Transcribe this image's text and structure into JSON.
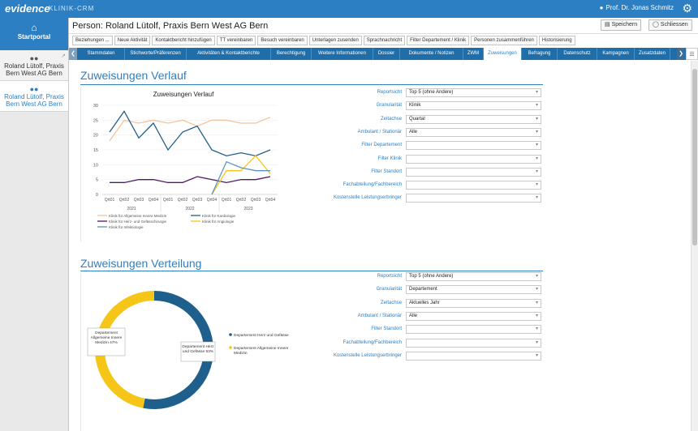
{
  "app": {
    "logo": "evidence",
    "subtitle": "KLINIK-CRM",
    "user": "Prof. Dr. Jonas Schmitz"
  },
  "sidebar": {
    "start": "Startportal",
    "items": [
      {
        "label": "Roland Lütolf, Praxis Bern West AG Bern"
      },
      {
        "label": "Roland Lütolf, Praxis Bern West AG Bern"
      }
    ]
  },
  "header": {
    "title": "Person: Roland Lütolf, Praxis Bern West AG Bern",
    "save": "Speichern",
    "close": "Schliessen"
  },
  "actions": [
    "Beziehungen ...",
    "Neue Aktivität",
    "Kontaktbericht hinzufügen",
    "TT vereinbaren",
    "Besuch vereinbaren",
    "Unterlagen zusenden",
    "Sprachnachricht",
    "Filter Departement / Klinik",
    "Personen zusammenführen",
    "Historisierung"
  ],
  "tabs": [
    "Stammdaten",
    "Stichworte/Präferenzen",
    "Aktivitäten & Kontaktberichte",
    "Berechtigung",
    "Weitere Informationen",
    "Dossier",
    "Dokumente / Notizen",
    "ZWM",
    "Zuweisungen",
    "Befragung",
    "Datenschutz",
    "Kampagnen",
    "Zusatzdaten"
  ],
  "active_tab": "Zuweisungen",
  "section1": {
    "title": "Zuweisungen Verlauf",
    "filters": [
      {
        "label": "Reportsicht",
        "value": "Top 5 (ohne Andere)"
      },
      {
        "label": "Granularität",
        "value": "Klinik"
      },
      {
        "label": "Zeitachse",
        "value": "Quartal"
      },
      {
        "label": "Ambulant / Stationär",
        "value": "Alle"
      },
      {
        "label": "Filter Departement",
        "value": ""
      },
      {
        "label": "Filter Klinik",
        "value": ""
      },
      {
        "label": "Filter Standort",
        "value": ""
      },
      {
        "label": "Fachabteilung/Fachbereich",
        "value": ""
      },
      {
        "label": "Kostenstelle Leistungserbringer",
        "value": ""
      }
    ]
  },
  "section2": {
    "title": "Zuweisungen Verteilung",
    "filters": [
      {
        "label": "Reportsicht",
        "value": "Top 5 (ohne Andere)"
      },
      {
        "label": "Granularität",
        "value": "Departement"
      },
      {
        "label": "Zeitachse",
        "value": "Aktuelles Jahr"
      },
      {
        "label": "Ambulant / Stationär",
        "value": "Alle"
      },
      {
        "label": "Filter Standort",
        "value": ""
      },
      {
        "label": "Fachabteilung/Fachbereich",
        "value": ""
      },
      {
        "label": "Kostenstelle Leistungserbringer",
        "value": ""
      }
    ]
  },
  "chart_data": [
    {
      "type": "line",
      "title": "Zuweisungen Verlauf",
      "categories": [
        "Qrt01",
        "Qrt02",
        "Qrt03",
        "Qrt04",
        "Qrt01",
        "Qrt02",
        "Qrt03",
        "Qrt04",
        "Qrt01",
        "Qrt02",
        "Qrt03",
        "Qrt04"
      ],
      "groups": [
        {
          "label": "2021",
          "from": 0,
          "to": 3
        },
        {
          "label": "2022",
          "from": 4,
          "to": 7
        },
        {
          "label": "2023",
          "from": 8,
          "to": 11
        }
      ],
      "ylim": [
        0,
        30
      ],
      "yticks": [
        0,
        5,
        10,
        15,
        20,
        25,
        30
      ],
      "legend_position": "bottom",
      "series": [
        {
          "name": "Klinik für Allgemeine Innere Medizin",
          "color": "#f4c49a",
          "values": [
            18,
            25,
            24,
            25,
            24,
            25,
            23,
            25,
            25,
            24,
            24,
            26
          ]
        },
        {
          "name": "Klinik für Kardiologie",
          "color": "#1f5f8b",
          "values": [
            21,
            28,
            19,
            24,
            15,
            21,
            23,
            15,
            13,
            14,
            13,
            15
          ]
        },
        {
          "name": "Klinik für Herz- und Gefässchirurgie",
          "color": "#4a1b5e",
          "values": [
            4,
            4,
            5,
            5,
            4,
            4,
            6,
            5,
            4,
            5,
            5,
            6
          ]
        },
        {
          "name": "Klinik für Angiologie",
          "color": "#f5c518",
          "values": [
            null,
            null,
            null,
            null,
            null,
            null,
            null,
            0,
            8,
            8,
            13,
            7
          ]
        },
        {
          "name": "Klinik für Infektiologie",
          "color": "#5d93c4",
          "values": [
            null,
            null,
            null,
            null,
            null,
            null,
            null,
            0,
            11,
            9,
            8,
            8
          ]
        }
      ]
    },
    {
      "type": "pie",
      "donut": true,
      "legend_position": "right",
      "slices": [
        {
          "label": "Departement Herz und Gefässe",
          "value": 53,
          "color": "#1f5f8b",
          "display": "Departement Herz und Gefässe 53%"
        },
        {
          "label": "Departement Allgemeine Innere Medizin",
          "value": 47,
          "color": "#f5c518",
          "display": "Departement Allgemeine Innere Medizin 47%"
        }
      ]
    }
  ]
}
